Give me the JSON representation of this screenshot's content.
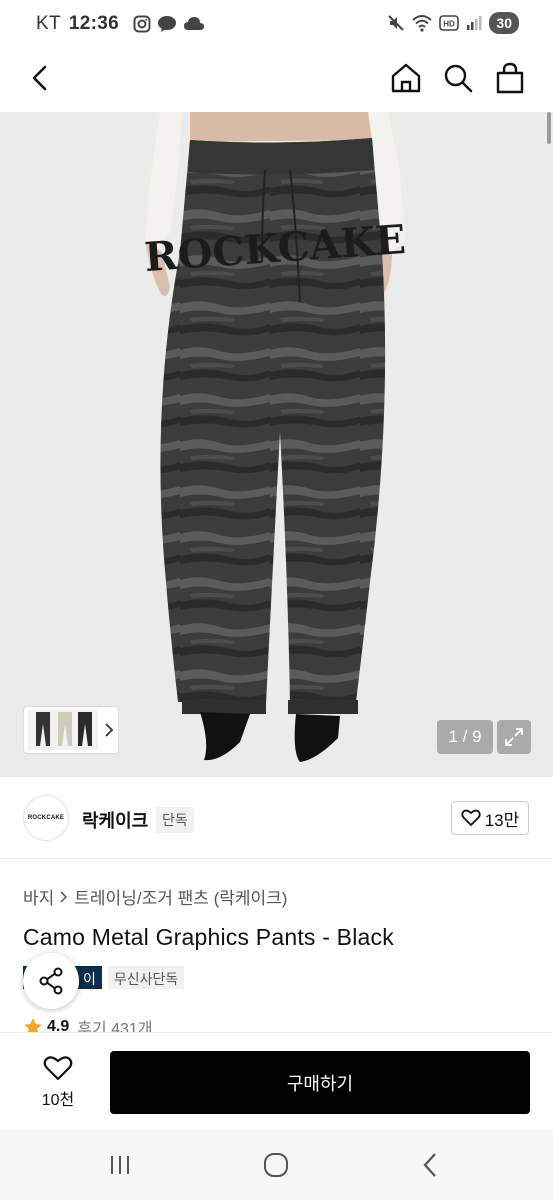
{
  "status_bar": {
    "carrier": "KT",
    "time": "12:36",
    "battery": "30",
    "icons": [
      "instagram-icon",
      "talk-icon",
      "cloud-icon",
      "mute-icon",
      "wifi-icon",
      "hd-icon",
      "signal-icon"
    ]
  },
  "header": {
    "icons": [
      "back-icon",
      "home-icon",
      "search-icon",
      "cart-icon"
    ]
  },
  "gallery": {
    "counter": "1 / 9",
    "thumb_count": 3
  },
  "brand": {
    "logo_text": "ROCKCAKE",
    "name": "락케이크",
    "badge": "단독",
    "likes": "13만"
  },
  "product": {
    "breadcrumb": [
      "바지",
      "트레이닝/조거 팬츠 (락케이크)"
    ],
    "title": "Camo Metal Graphics Pants - Black",
    "tags": [
      "이",
      "무신사단독"
    ],
    "rating": "4.9",
    "reviews": "후기 431개"
  },
  "bottom_bar": {
    "wish_count": "10천",
    "buy_label": "구매하기"
  },
  "colors": {
    "primary": "#000000",
    "star": "#f5a623",
    "exclusive_tag": "#0d2e4a"
  }
}
